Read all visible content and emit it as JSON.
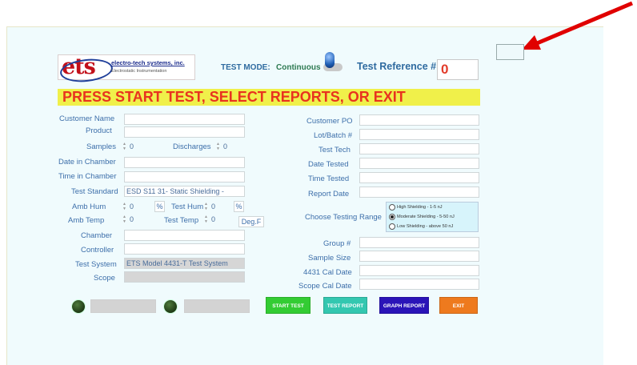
{
  "header": {
    "logo_mark": "ets",
    "company": "electro-tech systems, inc.",
    "tagline": "Electrostatic Instrumentation",
    "test_mode_label": "TEST MODE:",
    "test_mode_value": "Continuous",
    "test_reference_label": "Test Reference #",
    "test_reference_value": "0"
  },
  "banner": "PRESS START TEST, SELECT REPORTS, OR EXIT",
  "left_form": {
    "customer_name_label": "Customer Name",
    "product_label": "Product",
    "samples_label": "Samples",
    "samples_value": "0",
    "discharges_label": "Discharges",
    "discharges_value": "0",
    "date_in_chamber_label": "Date in Chamber",
    "time_in_chamber_label": "Time in Chamber",
    "test_standard_label": "Test Standard",
    "test_standard_value": "ESD S11 31- Static Shielding -",
    "amb_hum_label": "Amb Hum",
    "amb_hum_value": "0",
    "amb_hum_unit": "%",
    "test_hum_label": "Test Hum",
    "test_hum_value": "0",
    "test_hum_unit": "%",
    "amb_temp_label": "Amb Temp",
    "amb_temp_value": "0",
    "test_temp_label": "Test Temp",
    "test_temp_value": "0",
    "temp_unit": "Deg.F",
    "chamber_label": "Chamber",
    "controller_label": "Controller",
    "test_system_label": "Test System",
    "test_system_value": "ETS Model 4431-T Test System",
    "scope_label": "Scope"
  },
  "right_form": {
    "customer_po_label": "Customer PO",
    "lot_batch_label": "Lot/Batch #",
    "test_tech_label": "Test Tech",
    "date_tested_label": "Date Tested",
    "time_tested_label": "Time Tested",
    "report_date_label": "Report Date",
    "choose_range_label": "Choose Testing Range",
    "range_options": [
      "High Shielding - 1-5 nJ",
      "Moderate Shielding - 5-50 nJ",
      "Low Shielding  -  above 50 nJ"
    ],
    "range_selected": "Moderate Shielding - 5-50 nJ",
    "group_label": "Group #",
    "sample_size_label": "Sample Size",
    "cal_date_4431_label": "4431 Cal Date",
    "scope_cal_date_label": "Scope Cal Date"
  },
  "buttons": {
    "start_test": "START TEST",
    "test_report": "TEST REPORT",
    "graph_report": "GRAPH REPORT",
    "exit": "EXIT"
  },
  "colors": {
    "start_test": "#33cc33",
    "test_report": "#33c7b0",
    "graph_report": "#2a14b8",
    "exit": "#ee7a1e",
    "banner_bg": "#f0f04a",
    "banner_text": "#e8331f",
    "annotation_arrow": "#e00000"
  },
  "icons": {
    "toggle": "toggle-switch-icon",
    "led": "status-led-icon",
    "spinner": "spinner-arrows-icon",
    "pointer_arrow": "red-arrow-icon"
  }
}
